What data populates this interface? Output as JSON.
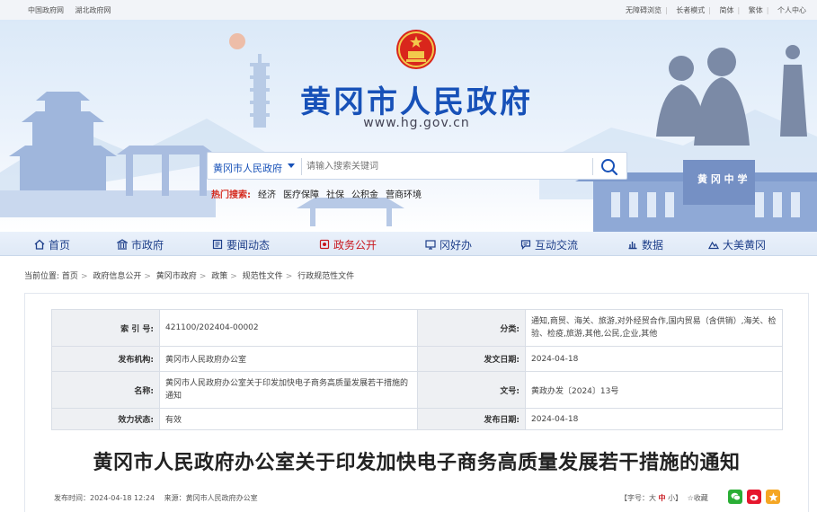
{
  "topbar": {
    "left_links": [
      "中国政府网",
      "湖北政府网"
    ],
    "right_links": [
      "无障碍浏览",
      "长者模式",
      "简体",
      "繁体",
      "个人中心"
    ]
  },
  "header": {
    "title": "黄冈市人民政府",
    "url": "www.hg.gov.cn",
    "school_sign": "黄 冈 中 学"
  },
  "search": {
    "scope": "黄冈市人民政府",
    "placeholder": "请输入搜索关键词"
  },
  "hot": {
    "label": "热门搜索:",
    "keywords": [
      "经济",
      "医疗保障",
      "社保",
      "公积金",
      "营商环境"
    ]
  },
  "nav": {
    "items": [
      {
        "label": "首页",
        "icon": "home-icon",
        "active": false
      },
      {
        "label": "市政府",
        "icon": "building-icon",
        "active": false
      },
      {
        "label": "要闻动态",
        "icon": "news-icon",
        "active": false
      },
      {
        "label": "政务公开",
        "icon": "document-icon",
        "active": true
      },
      {
        "label": "冈好办",
        "icon": "monitor-icon",
        "active": false
      },
      {
        "label": "互动交流",
        "icon": "chat-icon",
        "active": false
      },
      {
        "label": "数据",
        "icon": "chart-icon",
        "active": false
      },
      {
        "label": "大美黄冈",
        "icon": "mountain-icon",
        "active": false
      }
    ]
  },
  "breadcrumb": {
    "prefix": "当前位置:",
    "items": [
      "首页",
      "政府信息公开",
      "黄冈市政府",
      "政策",
      "规范性文件",
      "行政规范性文件"
    ]
  },
  "meta": {
    "index_label": "索 引 号:",
    "index_value": "421100/202404-00002",
    "category_label": "分类:",
    "category_value": "通知,商贸、海关、旅游,对外经贸合作,国内贸易（含供销）,海关、检验、检疫,旅游,其他,公民,企业,其他",
    "issuer_label": "发布机构:",
    "issuer_value": "黄冈市人民政府办公室",
    "issue_date_label": "发文日期:",
    "issue_date_value": "2024-04-18",
    "name_label": "名称:",
    "name_value": "黄冈市人民政府办公室关于印发加快电子商务高质量发展若干措施的通知",
    "docno_label": "文号:",
    "docno_value": "黄政办发〔2024〕13号",
    "status_label": "效力状态:",
    "status_value": "有效",
    "pub_date_label": "发布日期:",
    "pub_date_value": "2024-04-18"
  },
  "doc": {
    "title": "黄冈市人民政府办公室关于印发加快电子商务高质量发展若干措施的通知",
    "publish_time": "发布时间：2024-04-18 12:24",
    "source": "来源：黄冈市人民政府办公室",
    "fontsize_label": "【字号：",
    "fontsize_large": "大",
    "fontsize_medium": "中",
    "fontsize_small": "小】",
    "favorite": "收藏"
  },
  "colors": {
    "brand_blue": "#1751b8",
    "active_red": "#c8161d",
    "wechat_green": "#2aae35",
    "weibo_red": "#e6162d",
    "star_orange": "#f5a623"
  }
}
